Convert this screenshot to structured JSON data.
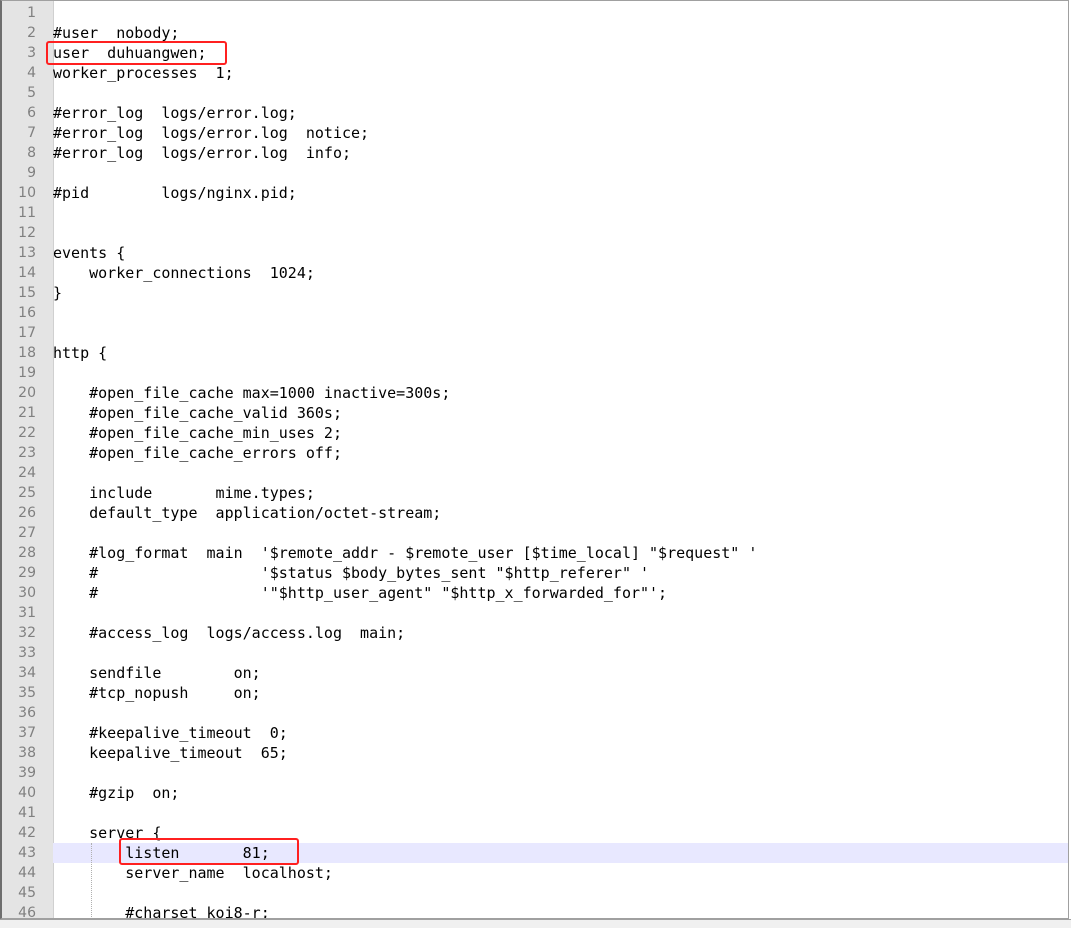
{
  "editor": {
    "start_line": 1,
    "current_line": 43,
    "highlighted_lines": [
      3,
      43
    ],
    "highlight_color": "#ff2020",
    "lines": [
      "",
      "#user  nobody;",
      "user  duhuangwen;",
      "worker_processes  1;",
      "",
      "#error_log  logs/error.log;",
      "#error_log  logs/error.log  notice;",
      "#error_log  logs/error.log  info;",
      "",
      "#pid        logs/nginx.pid;",
      "",
      "",
      "events {",
      "    worker_connections  1024;",
      "}",
      "",
      "",
      "http {",
      "",
      "    #open_file_cache max=1000 inactive=300s;",
      "    #open_file_cache_valid 360s;",
      "    #open_file_cache_min_uses 2;",
      "    #open_file_cache_errors off;",
      "",
      "    include       mime.types;",
      "    default_type  application/octet-stream;",
      "",
      "    #log_format  main  '$remote_addr - $remote_user [$time_local] \"$request\" '",
      "    #                  '$status $body_bytes_sent \"$http_referer\" '",
      "    #                  '\"$http_user_agent\" \"$http_x_forwarded_for\"';",
      "",
      "    #access_log  logs/access.log  main;",
      "",
      "    sendfile        on;",
      "    #tcp_nopush     on;",
      "",
      "    #keepalive_timeout  0;",
      "    keepalive_timeout  65;",
      "",
      "    #gzip  on;",
      "",
      "    server {",
      "        listen       81;",
      "        server_name  localhost;",
      "",
      "        #charset koi8-r;"
    ]
  }
}
